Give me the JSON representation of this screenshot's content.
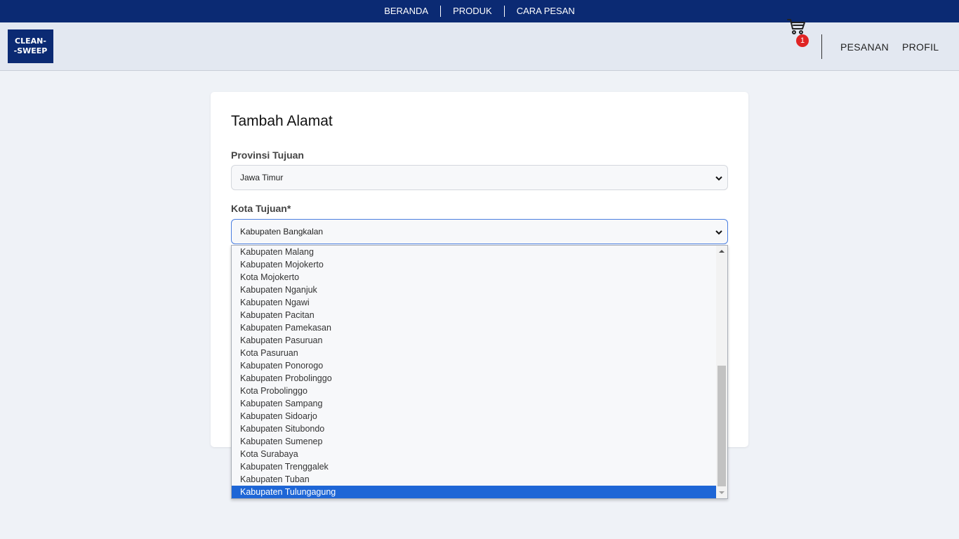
{
  "topnav": {
    "items": [
      "BERANDA",
      "PRODUK",
      "CARA PESAN"
    ]
  },
  "header": {
    "logo_line1": "CLEAN-",
    "logo_line2": "-SWEEP",
    "cart_count": "1",
    "links": [
      "PESANAN",
      "PROFIL"
    ]
  },
  "form": {
    "title": "Tambah Alamat",
    "province_label": "Provinsi Tujuan",
    "province_value": "Jawa Timur",
    "city_label": "Kota Tujuan*",
    "city_value": "Kabupaten Bangkalan"
  },
  "dropdown": {
    "options": [
      "Kabupaten Malang",
      "Kabupaten Mojokerto",
      "Kota Mojokerto",
      "Kabupaten Nganjuk",
      "Kabupaten Ngawi",
      "Kabupaten Pacitan",
      "Kabupaten Pamekasan",
      "Kabupaten Pasuruan",
      "Kota Pasuruan",
      "Kabupaten Ponorogo",
      "Kabupaten Probolinggo",
      "Kota Probolinggo",
      "Kabupaten Sampang",
      "Kabupaten Sidoarjo",
      "Kabupaten Situbondo",
      "Kabupaten Sumenep",
      "Kota Surabaya",
      "Kabupaten Trenggalek",
      "Kabupaten Tuban",
      "Kabupaten Tulungagung"
    ],
    "highlighted": "Kabupaten Tulungagung"
  },
  "colors": {
    "navy": "#0b2a73",
    "selected": "#1e66d6",
    "badge": "#e02424"
  }
}
